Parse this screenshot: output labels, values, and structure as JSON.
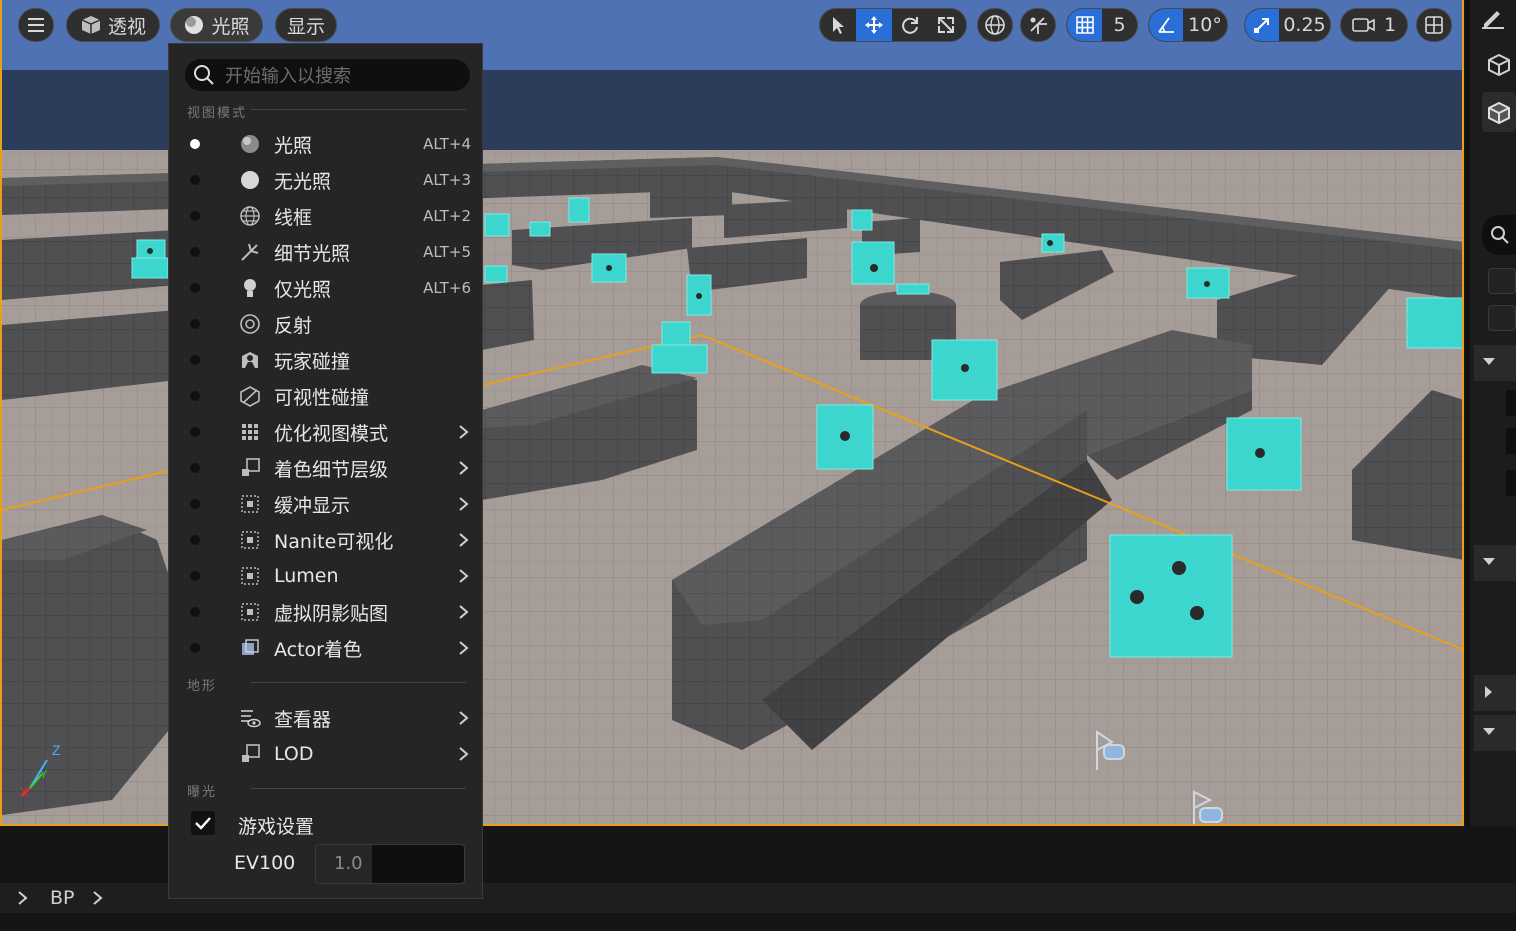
{
  "toolbar": {
    "perspective_label": "透视",
    "lighting_label": "光照",
    "show_label": "显示",
    "grid_snap_value": "5",
    "rotation_snap_value": "10°",
    "scale_snap_value": "0.25",
    "camera_speed_value": "1"
  },
  "view_menu": {
    "search_placeholder": "开始输入以搜索",
    "section_view_mode": "视图模式",
    "section_landscape": "地形",
    "section_exposure": "曝光",
    "items": [
      {
        "label": "光照",
        "shortcut": "ALT+4",
        "icon": "lit-sphere-icon",
        "selected": true
      },
      {
        "label": "无光照",
        "shortcut": "ALT+3",
        "icon": "unlit-sphere-icon"
      },
      {
        "label": "线框",
        "shortcut": "ALT+2",
        "icon": "wireframe-globe-icon"
      },
      {
        "label": "细节光照",
        "shortcut": "ALT+5",
        "icon": "detail-lighting-icon"
      },
      {
        "label": "仅光照",
        "shortcut": "ALT+6",
        "icon": "lightbulb-icon"
      },
      {
        "label": "反射",
        "shortcut": "",
        "icon": "reflection-icon"
      },
      {
        "label": "玩家碰撞",
        "shortcut": "",
        "icon": "player-collision-icon"
      },
      {
        "label": "可视性碰撞",
        "shortcut": "",
        "icon": "visibility-collision-icon"
      },
      {
        "label": "优化视图模式",
        "shortcut": "",
        "icon": "optimization-grid-icon",
        "submenu": true
      },
      {
        "label": "着色细节层级",
        "shortcut": "",
        "icon": "lod-coloration-icon",
        "submenu": true
      },
      {
        "label": "缓冲显示",
        "shortcut": "",
        "icon": "buffer-grid-icon",
        "submenu": true
      },
      {
        "label": "Nanite可视化",
        "shortcut": "",
        "icon": "nanite-grid-icon",
        "submenu": true
      },
      {
        "label": "Lumen",
        "shortcut": "",
        "icon": "lumen-grid-icon",
        "submenu": true
      },
      {
        "label": "虚拟阴影贴图",
        "shortcut": "",
        "icon": "shadow-map-grid-icon",
        "submenu": true
      },
      {
        "label": "Actor着色",
        "shortcut": "",
        "icon": "actor-coloration-icon",
        "submenu": true
      }
    ],
    "landscape_items": [
      {
        "label": "查看器",
        "icon": "viewer-icon",
        "submenu": true
      },
      {
        "label": "LOD",
        "icon": "lod-icon",
        "submenu": true
      }
    ],
    "game_settings_label": "游戏设置",
    "game_settings_checked": true,
    "ev100_label": "EV100",
    "ev100_value": "1.0"
  },
  "breadcrumb": {
    "item": "BP"
  },
  "colors": {
    "accent_blue": "#2a6ed8",
    "selection_orange": "#e8a019",
    "cube_cyan": "#3cd6cf"
  }
}
